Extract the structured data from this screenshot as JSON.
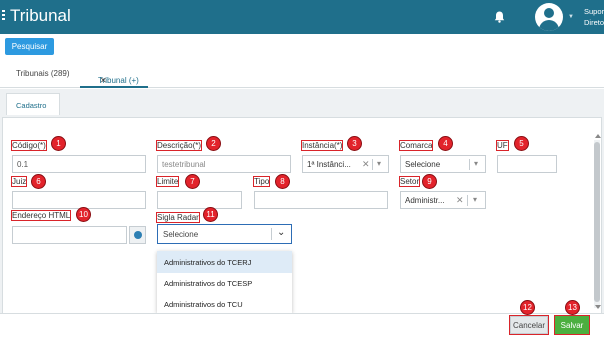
{
  "header": {
    "title": "Tribunal",
    "user_line1": "Supor",
    "user_line2": "Direto"
  },
  "toolbar": {
    "search_label": "Pesquisar"
  },
  "tabs": [
    {
      "label": "Tribunais (289)"
    },
    {
      "label": "Tribunal (+)",
      "close": "✕"
    }
  ],
  "subtab": {
    "label": "Cadastro"
  },
  "form": {
    "codigo": {
      "label": "Código(*)",
      "value": "0.1"
    },
    "descricao": {
      "label": "Descrição(*)",
      "value": "testetribunal"
    },
    "instancia": {
      "label": "Instância(*)",
      "value": "1ª Instânci..."
    },
    "comarca": {
      "label": "Comarca",
      "value": "Selecione"
    },
    "uf": {
      "label": "UF",
      "value": ""
    },
    "juiz": {
      "label": "Juiz",
      "value": ""
    },
    "limite": {
      "label": "Limite",
      "value": ""
    },
    "tipo": {
      "label": "Tipo",
      "value": ""
    },
    "setor": {
      "label": "Setor",
      "value": "Administr..."
    },
    "endereco_html": {
      "label": "Endereço HTML",
      "value": ""
    },
    "sigla_radar": {
      "label": "Sigla Radar",
      "value": "Selecione"
    }
  },
  "dropdown": {
    "options": [
      "Administrativos do TCERJ",
      "Administrativos do TCESP",
      "Administrativos do TCU"
    ]
  },
  "badges": [
    "1",
    "2",
    "3",
    "4",
    "5",
    "6",
    "7",
    "8",
    "9",
    "10",
    "11",
    "12",
    "13"
  ],
  "footer": {
    "cancel_label": "Cancelar",
    "save_label": "Salvar"
  },
  "colors": {
    "header_bg": "#1f6f8b",
    "primary_button": "#2d9ae0",
    "save_button": "#4caf3f",
    "annotation_red": "#e2232b"
  }
}
